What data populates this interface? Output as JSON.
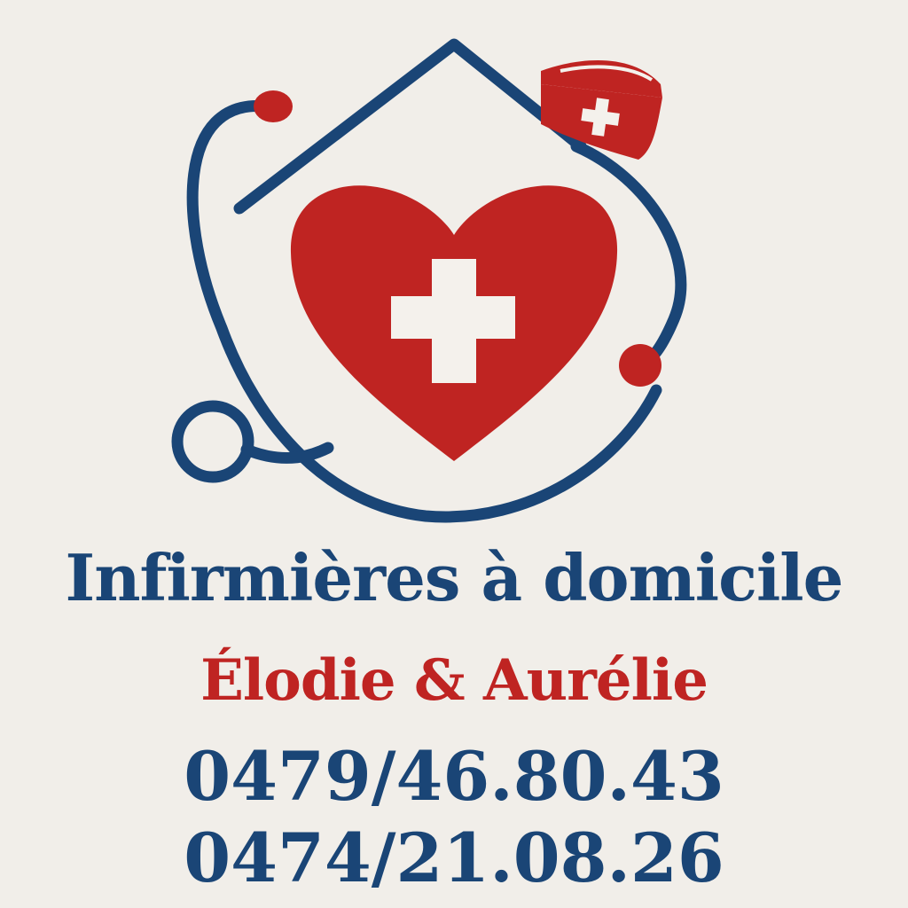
{
  "colors": {
    "background": "#f1eee9",
    "navy": "#1a4576",
    "red": "#bf2422",
    "white": "#f4f1ec"
  },
  "logo": {
    "icons": [
      "house-outline-icon",
      "stethoscope-icon",
      "heart-icon",
      "medical-cross-icon",
      "nurse-cap-icon"
    ]
  },
  "text": {
    "title": "Infirmières à domicile",
    "subtitle": "Élodie & Aurélie",
    "phone_1": "0479/46.80.43",
    "phone_2": "0474/21.08.26"
  }
}
